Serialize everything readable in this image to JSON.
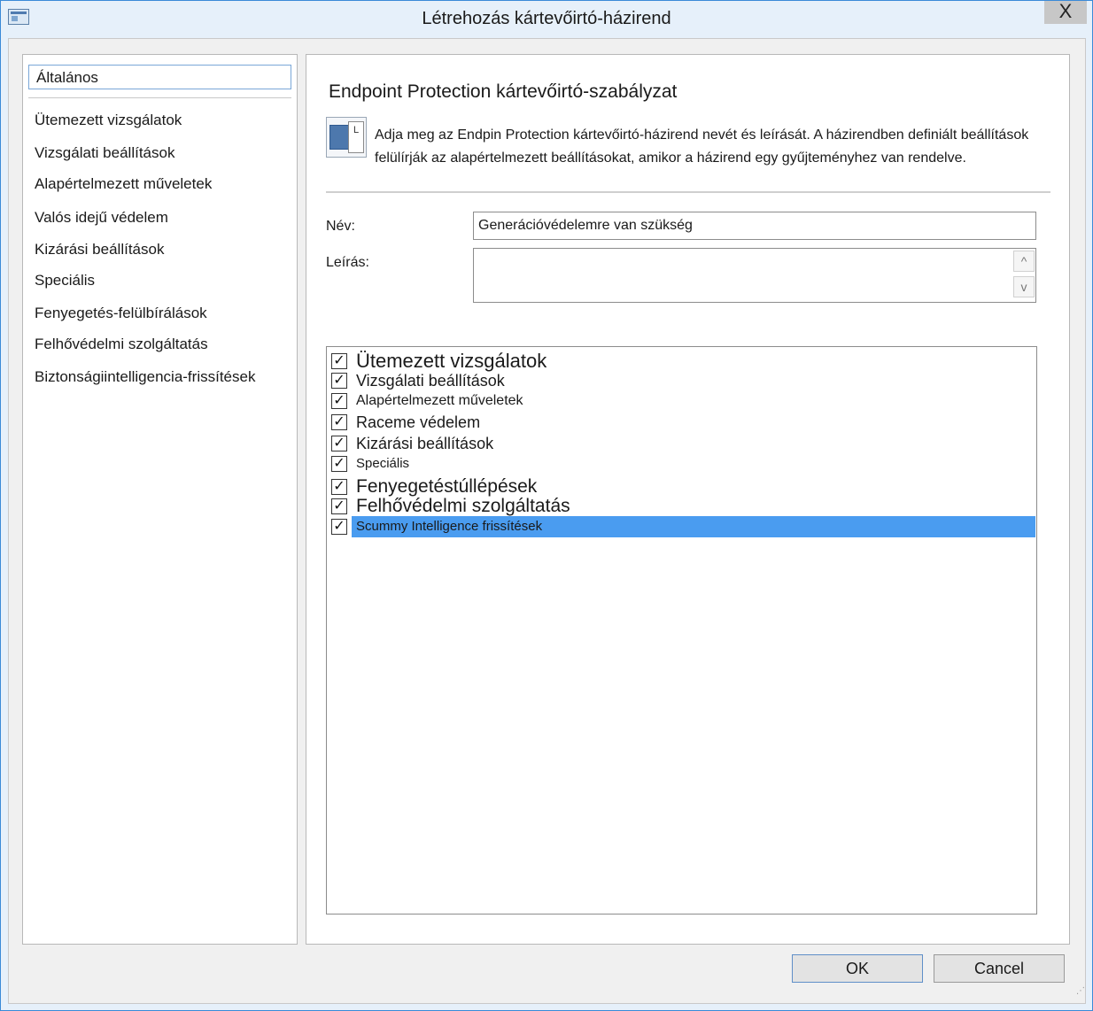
{
  "window": {
    "title": "Létrehozás kártevőirtó-házirend",
    "close_glyph": "X"
  },
  "sidebar": {
    "items": [
      {
        "label": "Általános",
        "selected": true
      },
      {
        "label": "Ütemezett vizsgálatok"
      },
      {
        "label": "Vizsgálati beállítások"
      },
      {
        "label": "Alapértelmezett műveletek"
      },
      {
        "label": "Valós idejű védelem"
      },
      {
        "label": "Kizárási beállítások"
      },
      {
        "label": "Speciális"
      },
      {
        "label": "Fenyegetés-felülbírálások"
      },
      {
        "label": "Felhővédelmi szolgáltatás"
      },
      {
        "label": "Biztonságiintelligencia-frissítések"
      }
    ]
  },
  "main": {
    "heading": "Endpoint Protection kártevőirtó-szabályzat",
    "icon_letter": "L",
    "description": "Adja meg az Endpin Protection kártevőirtó-házirend nevét és leírását. A házirendben definiált beállítások felülírják az alapértelmezett beállításokat, amikor a házirend egy gyűjteményhez van rendelve.",
    "name_label": "Név:",
    "name_value": "Generációvédelemre van szükség",
    "description_label": "Leírás:",
    "description_value": "",
    "scroll_up_glyph": "^",
    "scroll_down_glyph": "v",
    "checklist": [
      {
        "label": "Ütemezett vizsgálatok",
        "checked": true
      },
      {
        "label": "Vizsgálati beállítások",
        "checked": true
      },
      {
        "label": "Alapértelmezett műveletek",
        "checked": true
      },
      {
        "label": "Raceme védelem",
        "checked": true
      },
      {
        "label": "Kizárási beállítások",
        "checked": true
      },
      {
        "label": "Speciális",
        "checked": true
      },
      {
        "label": "Fenyegetéstúllépések",
        "checked": true
      },
      {
        "label": "Felhővédelmi szolgáltatás",
        "checked": true
      },
      {
        "label": "Scummy Intelligence frissítések",
        "checked": true,
        "selected": true
      }
    ],
    "check_glyph": "✓"
  },
  "buttons": {
    "ok_label": "OK",
    "cancel_label": "Cancel"
  },
  "colors": {
    "selection": "#4a9cf0",
    "window_frame": "#3a8ad8",
    "close_button": "#c7c7c7"
  }
}
